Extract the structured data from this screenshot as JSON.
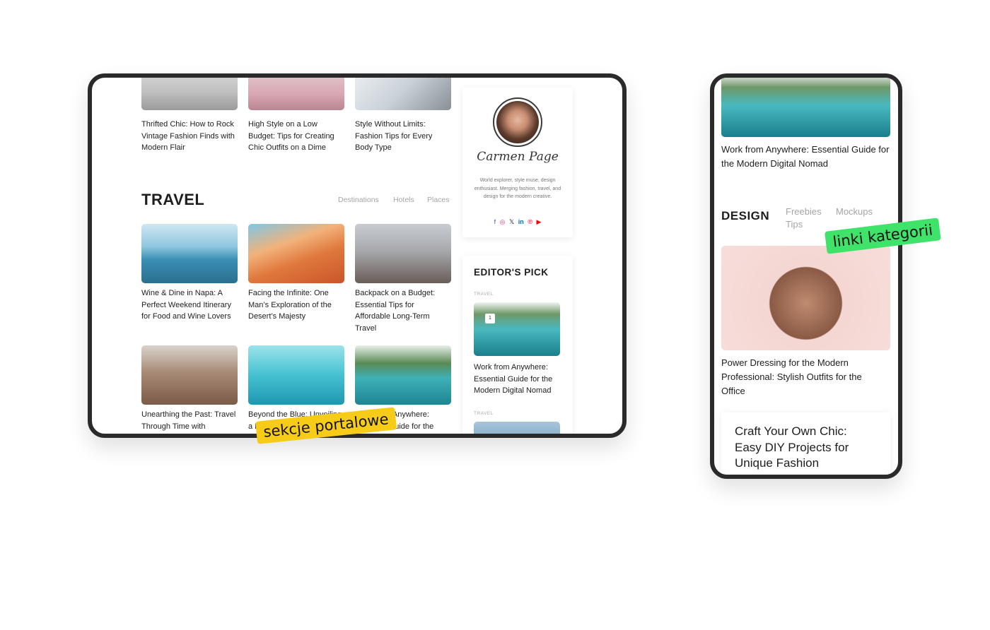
{
  "desktop": {
    "top_row": [
      {
        "title": "Thrifted Chic: How to Rock Vintage Fashion Finds with Modern Flair"
      },
      {
        "title": "High Style on a Low Budget: Tips for Creating Chic Outfits on a Dime"
      },
      {
        "title": "Style Without Limits: Fashion Tips for Every Body Type"
      }
    ],
    "travel": {
      "heading": "TRAVEL",
      "links": [
        "Destinations",
        "Hotels",
        "Places"
      ],
      "row1": [
        {
          "title": "Wine & Dine in Napa: A Perfect Weekend Itinerary for Food and Wine Lovers"
        },
        {
          "title": "Facing the Infinite: One Man’s Exploration of the Desert’s Majesty"
        },
        {
          "title": "Backpack on a Budget: Essential Tips for Affordable Long-Term Travel"
        }
      ],
      "row2": [
        {
          "title": "Unearthing the Past: Travel Through Time with"
        },
        {
          "title": "Beyond the Blue: Unveiling a Hidden World Teeming"
        },
        {
          "title": "Work from Anywhere: Essential Guide for the"
        }
      ]
    },
    "author": {
      "name": "Carmen Page",
      "bio": "World explorer, style muse, design enthusiast. Merging fashion, travel, and design for the modern creative.",
      "socials": [
        "facebook-icon",
        "instagram-icon",
        "x-icon",
        "linkedin-icon",
        "pinterest-icon",
        "youtube-icon"
      ],
      "social_glyphs": [
        "f",
        "◎",
        "𝕏",
        "in",
        "℗",
        "▶"
      ]
    },
    "editors_pick": {
      "heading": "EDITOR'S PICK",
      "items": [
        {
          "category": "TRAVEL",
          "number": "1",
          "title": "Work from Anywhere: Essential Guide for the Modern Digital Nomad"
        },
        {
          "category": "TRAVEL"
        }
      ]
    }
  },
  "mobile": {
    "top_article": {
      "title": "Work from Anywhere: Essential Guide for the Modern Digital Nomad"
    },
    "design": {
      "heading": "DESIGN",
      "links": [
        "Freebies",
        "Mockups",
        "Tips"
      ],
      "article": {
        "title": "Power Dressing for the Modern Professional: Stylish Outfits for the Office"
      }
    },
    "bottom_card": {
      "title": "Craft Your Own Chic: Easy DIY Projects for Unique Fashion"
    }
  },
  "stickers": {
    "sections": "sekcje portalowe",
    "category_links": "linki kategorii"
  },
  "colors": {
    "sticker_yellow": "#f7cc18",
    "sticker_green": "#3fe36a",
    "frame": "#2a2a2a",
    "muted_link": "#a5a5a5"
  }
}
